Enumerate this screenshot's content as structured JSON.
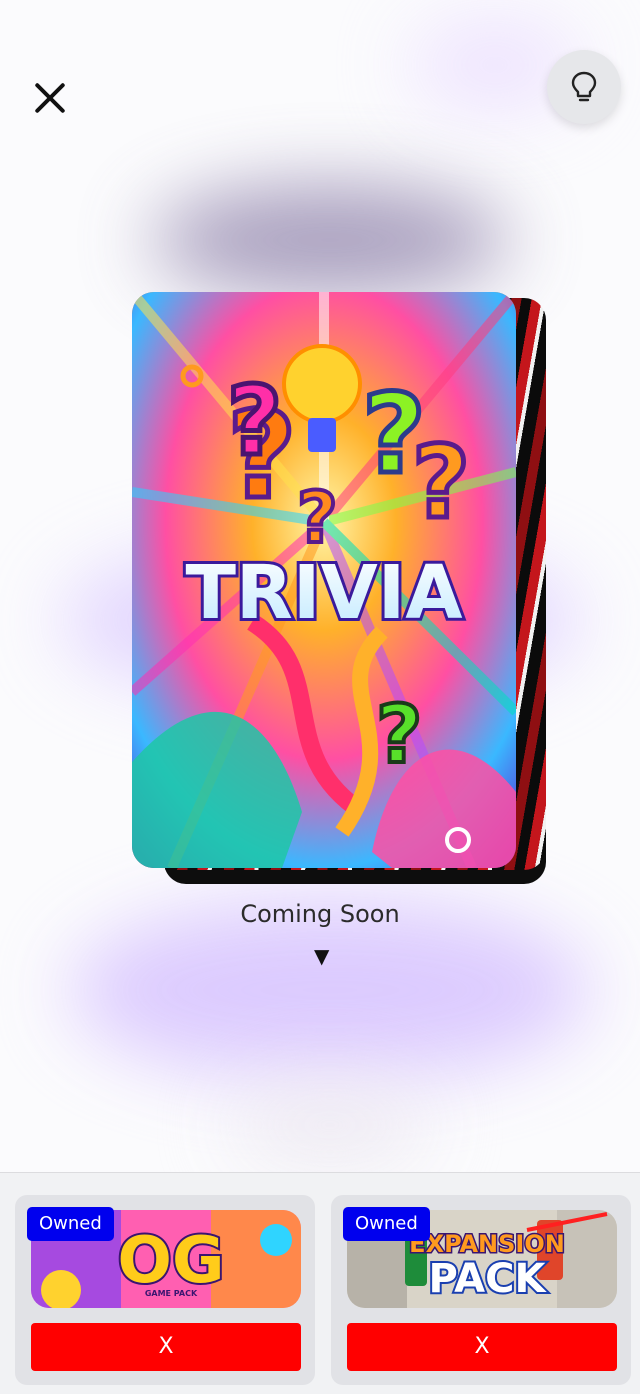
{
  "header": {
    "close_icon": "close-icon",
    "hint_icon": "lightbulb-icon"
  },
  "main": {
    "card": {
      "title": "TRIVIA"
    },
    "status": "Coming Soon",
    "expand_icon": "triangle-down-icon"
  },
  "packs": [
    {
      "badge": "Owned",
      "art_text": "OG",
      "art_subtext": "GAME PACK",
      "remove_label": "X"
    },
    {
      "badge": "Owned",
      "art_text_line1": "EXPANSION",
      "art_text_line2": "PACK",
      "remove_label": "X"
    }
  ],
  "colors": {
    "owned_badge": "#0000ee",
    "remove_button": "#ff0000"
  }
}
